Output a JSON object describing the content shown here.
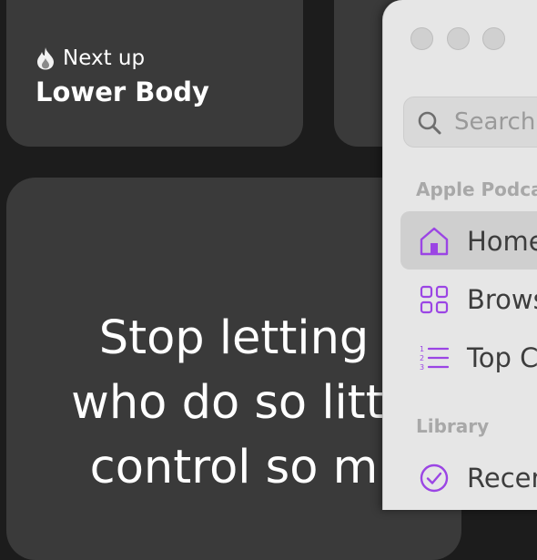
{
  "next_up_card": {
    "label": "Next up",
    "workout": "Lower Body",
    "icon": "flame-icon"
  },
  "quote_card": {
    "lines": [
      "Stop letting",
      "who do so littl",
      "control so m"
    ]
  },
  "podcasts_window": {
    "search": {
      "placeholder": "Search"
    },
    "sections": [
      {
        "title": "Apple Podca",
        "items": [
          {
            "label": "Home",
            "icon": "house-icon",
            "selected": true
          },
          {
            "label": "Brows",
            "icon": "grid-icon",
            "selected": false
          },
          {
            "label": "Top C",
            "icon": "numbered-list-icon",
            "selected": false
          }
        ]
      },
      {
        "title": "Library",
        "items": [
          {
            "label": "Recen",
            "icon": "checkmark-circle-icon",
            "selected": false
          }
        ]
      }
    ],
    "accent_color": "#9b45e4"
  }
}
